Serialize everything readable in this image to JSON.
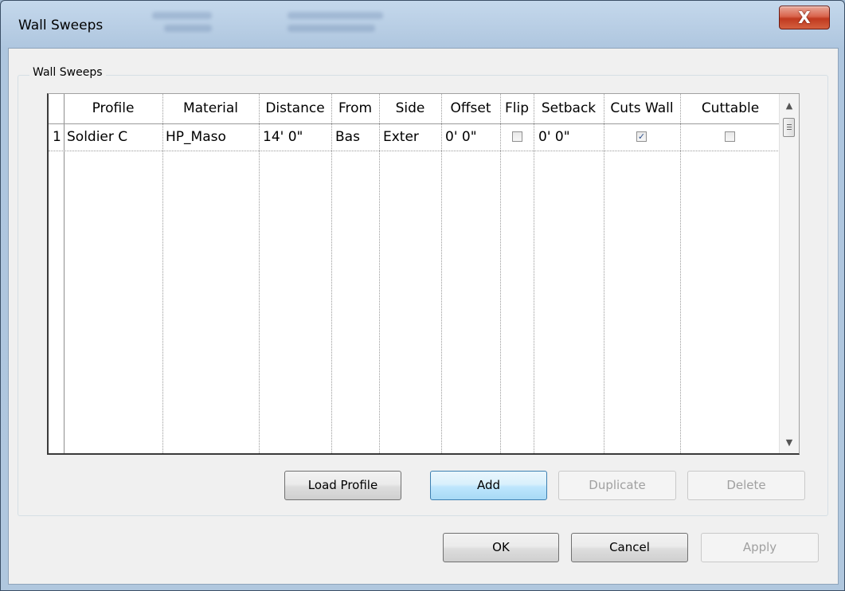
{
  "window": {
    "title": "Wall Sweeps",
    "close_glyph": "X"
  },
  "group": {
    "label": "Wall Sweeps"
  },
  "table": {
    "columns": [
      "Profile",
      "Material",
      "Distance",
      "From",
      "Side",
      "Offset",
      "Flip",
      "Setback",
      "Cuts Wall",
      "Cuttable"
    ],
    "rows": [
      {
        "number": "1",
        "profile": "Soldier C",
        "material": "HP_Maso",
        "distance": "14'  0\"",
        "from": "Bas",
        "side": "Exter",
        "offset": "0'  0\"",
        "flip": false,
        "setback": "0'  0\"",
        "cuts_wall": true,
        "cuttable": false
      }
    ]
  },
  "buttons": {
    "load_profile": "Load Profile",
    "add": "Add",
    "duplicate": "Duplicate",
    "delete": "Delete",
    "ok": "OK",
    "cancel": "Cancel",
    "apply": "Apply"
  },
  "icons": {
    "scroll_up": "scroll-up-arrow-icon",
    "scroll_down": "scroll-down-arrow-icon",
    "checkmark": "checkmark-icon"
  },
  "colors": {
    "close_button": "#c8432a",
    "focused_button": "#bee6fd",
    "frame": "#b6cce3"
  }
}
